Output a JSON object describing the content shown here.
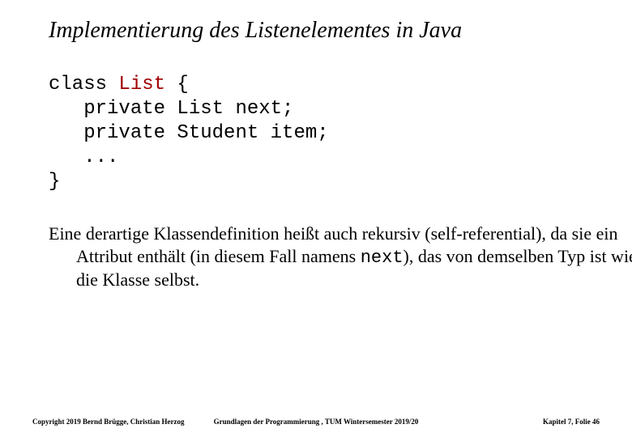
{
  "title": "Implementierung des Listenelementes in Java",
  "code": {
    "l1_a": "class ",
    "l1_b": "List",
    "l1_c": " {",
    "l2": "   private List next;",
    "l3": "   private Student item;",
    "l4": "   ...",
    "l5": "}"
  },
  "body": {
    "t1": "Eine derartige Klassendefinition heißt auch rekursiv (self-referential), da sie ein Attribut enthält (in diesem Fall namens ",
    "mono": "next",
    "t2": "), das von demselben Typ ist wie die Klasse selbst."
  },
  "footer": {
    "left": "Copyright 2019 Bernd Brügge, Christian Herzog",
    "center": "Grundlagen der Programmierung , TUM Wintersemester 2019/20",
    "right": "Kapitel 7, Folie 46"
  }
}
